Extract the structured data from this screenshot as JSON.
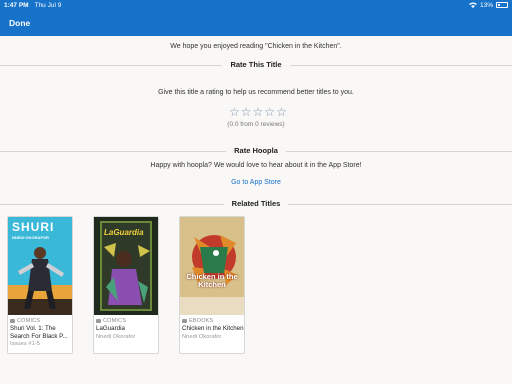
{
  "status_bar": {
    "time": "1:47 PM",
    "date": "Thu Jul 9",
    "battery": "13%"
  },
  "nav": {
    "done_label": "Done"
  },
  "thanks_text": "We hope you enjoyed reading \"Chicken in the Kitchen\".",
  "rate_title": {
    "heading": "Rate This Title",
    "prompt": "Give this title a rating to help us recommend better titles to you.",
    "stars": [
      "☆",
      "☆",
      "☆",
      "☆",
      "☆"
    ],
    "summary": "(0.0 from 0 reviews)"
  },
  "rate_hoopla": {
    "heading": "Rate Hoopla",
    "prompt": "Happy with hoopla? We would love to hear about it in the App Store!",
    "link": "Go to App Store"
  },
  "related": {
    "heading": "Related Titles",
    "items": [
      {
        "format": "COMICS",
        "title": "Shuri Vol. 1: The Search For Black P...",
        "subtitle": "Issues #1-5",
        "cover_title": "SHURI",
        "cover_author": "NNEDI OKORAFOR",
        "cover_color": "#39b8d8"
      },
      {
        "format": "COMICS",
        "title": "LaGuardia",
        "subtitle": "Nnedi Okorafor",
        "cover_title": "LaGuardia",
        "cover_author": "",
        "cover_color": "#1f2a1c"
      },
      {
        "format": "EBOOKS",
        "title": "Chicken in the Kitchen",
        "subtitle": "Nnedi Okorafor",
        "cover_title": "Chicken in the Kitchen",
        "cover_author": "",
        "cover_color": "#c9a84a"
      }
    ]
  },
  "colors": {
    "accent": "#1773c9"
  }
}
